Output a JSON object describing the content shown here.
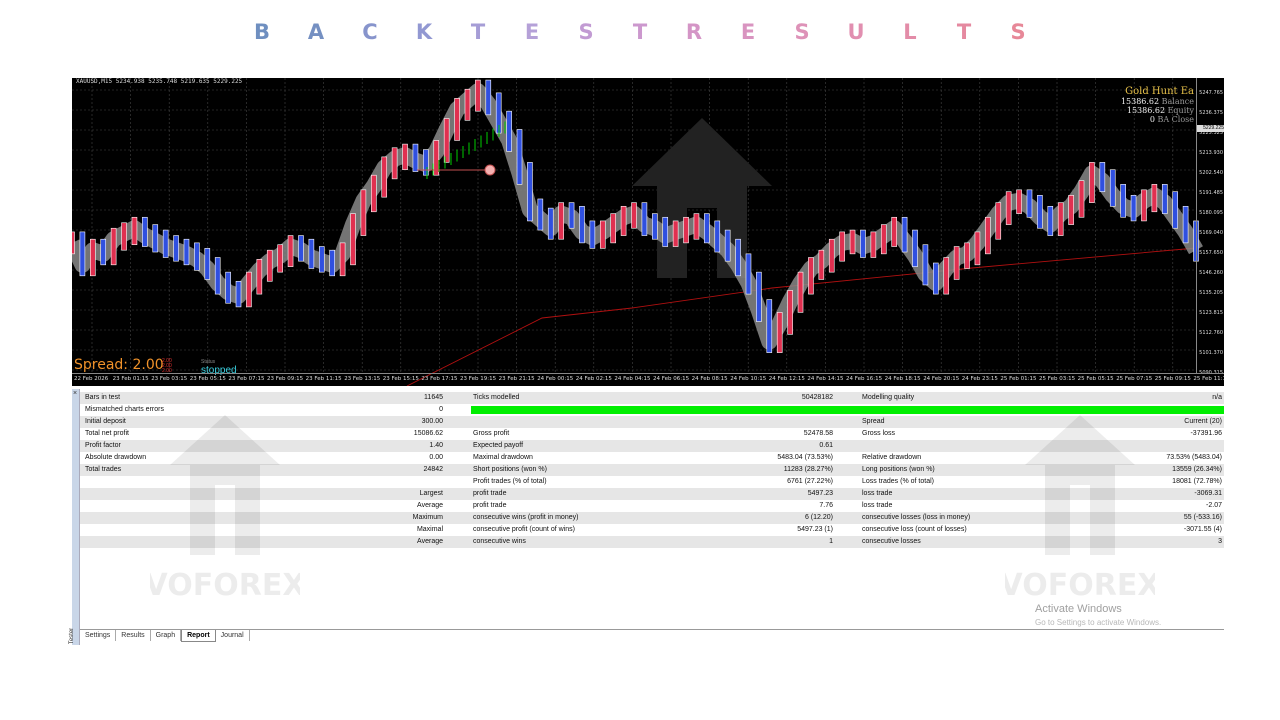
{
  "page_title": {
    "letters": [
      "B",
      "A",
      "C",
      "K",
      "T",
      "E",
      "S",
      "T",
      "R",
      "E",
      "S",
      "U",
      "L",
      "T",
      "S"
    ],
    "colors": [
      "#6f8fc0",
      "#7590c2",
      "#8794cc",
      "#9298d2",
      "#a69dd6",
      "#b5a1d8",
      "#c29bd3",
      "#cc98ce",
      "#d495c6",
      "#d994c0",
      "#de92b8",
      "#e18fb0",
      "#e38ca8",
      "#e589a0",
      "#e78898"
    ]
  },
  "chart": {
    "header": "XAUUSD,M15  5234.938 5235.748 5219.635 5229.225",
    "ea_title": "Gold Hunt Ea",
    "ea_lines": [
      {
        "value": "15386.62",
        "label": "Balance"
      },
      {
        "value": "15386.62",
        "label": "Equity"
      },
      {
        "value": "0",
        "label": "BA Close"
      }
    ],
    "price_labels": [
      "5247.765",
      "5236.375",
      "5225.325",
      "5213.930",
      "5202.540",
      "5191.485",
      "5180.095",
      "5169.040",
      "5157.650",
      "5146.260",
      "5135.205",
      "5123.815",
      "5112.760",
      "5101.370",
      "5090.315"
    ],
    "current_price": "5229.225",
    "spread_text": "Spread: 2.00",
    "spread_small": [
      "2.00",
      "2.00",
      "2.00"
    ],
    "status_label": "Status",
    "status_value": "stopped",
    "time_labels": [
      "22 Feb 2026",
      "23 Feb 01:15",
      "23 Feb 03:15",
      "23 Feb 05:15",
      "23 Feb 07:15",
      "23 Feb 09:15",
      "23 Feb 11:15",
      "23 Feb 13:15",
      "23 Feb 15:15",
      "23 Feb 17:15",
      "23 Feb 19:15",
      "23 Feb 21:15",
      "24 Feb 00:15",
      "24 Feb 02:15",
      "24 Feb 04:15",
      "24 Feb 06:15",
      "24 Feb 08:15",
      "24 Feb 10:15",
      "24 Feb 12:15",
      "24 Feb 14:15",
      "24 Feb 16:15",
      "24 Feb 18:15",
      "24 Feb 20:15",
      "24 Feb 23:15",
      "25 Feb 01:15",
      "25 Feb 03:15",
      "25 Feb 05:15",
      "25 Feb 07:15",
      "25 Feb 09:15",
      "25 Feb 11:1"
    ],
    "colors": {
      "background": "#000000",
      "grid": "#444444",
      "candle_up": "#e03050",
      "candle_down": "#3050e0",
      "glow": "#888888",
      "ma_line": "#b01010",
      "buy_marker": "#00cc00"
    },
    "price_series": [
      5162,
      5150,
      5158,
      5156,
      5164,
      5167,
      5170,
      5166,
      5163,
      5160,
      5158,
      5156,
      5153,
      5148,
      5140,
      5135,
      5133,
      5140,
      5147,
      5152,
      5155,
      5160,
      5158,
      5154,
      5152,
      5150,
      5156,
      5172,
      5185,
      5193,
      5203,
      5208,
      5210,
      5207,
      5205,
      5212,
      5224,
      5235,
      5240,
      5245,
      5238,
      5228,
      5218,
      5200,
      5180,
      5175,
      5170,
      5178,
      5176,
      5168,
      5165,
      5168,
      5172,
      5176,
      5178,
      5172,
      5170,
      5166,
      5168,
      5170,
      5172,
      5168,
      5163,
      5158,
      5150,
      5140,
      5125,
      5108,
      5118,
      5130,
      5140,
      5148,
      5152,
      5158,
      5162,
      5163,
      5160,
      5162,
      5166,
      5170,
      5163,
      5155,
      5145,
      5140,
      5148,
      5154,
      5156,
      5162,
      5170,
      5178,
      5184,
      5185,
      5182,
      5176,
      5172,
      5178,
      5182,
      5190,
      5200,
      5196,
      5188,
      5182,
      5180,
      5185,
      5188,
      5184,
      5176,
      5168,
      5158
    ]
  },
  "report": {
    "rows": [
      {
        "c1": "Bars in test",
        "v1": "11645",
        "c2": "Ticks modelled",
        "v2": "50428182",
        "c3": "Modelling quality",
        "v3": "n/a",
        "shade": true
      },
      {
        "c1": "Mismatched charts errors",
        "v1": "0",
        "c2": "",
        "v2": "",
        "c3": "",
        "v3": "",
        "shade": false,
        "bar": true
      },
      {
        "c1": "Initial deposit",
        "v1": "300.00",
        "c2": "",
        "v2": "",
        "c3": "Spread",
        "v3": "Current (20)",
        "shade": true
      },
      {
        "c1": "Total net profit",
        "v1": "15086.62",
        "c2": "Gross profit",
        "v2": "52478.58",
        "c3": "Gross loss",
        "v3": "-37391.96",
        "shade": false
      },
      {
        "c1": "Profit factor",
        "v1": "1.40",
        "c2": "Expected payoff",
        "v2": "0.61",
        "c3": "",
        "v3": "",
        "shade": true
      },
      {
        "c1": "Absolute drawdown",
        "v1": "0.00",
        "c2": "Maximal drawdown",
        "v2": "5483.04 (73.53%)",
        "c3": "Relative drawdown",
        "v3": "73.53% (5483.04)",
        "shade": false
      },
      {
        "c1": "Total trades",
        "v1": "24842",
        "c2": "Short positions (won %)",
        "v2": "11283 (28.27%)",
        "c3": "Long positions (won %)",
        "v3": "13559 (26.34%)",
        "shade": true
      },
      {
        "c1": "",
        "v1": "",
        "c2": "Profit trades (% of total)",
        "v2": "6761 (27.22%)",
        "c3": "Loss trades (% of total)",
        "v3": "18081 (72.78%)",
        "shade": false
      },
      {
        "c1": "",
        "v1": "Largest",
        "c2": "profit trade",
        "v2": "5497.23",
        "c3": "loss trade",
        "v3": "-3069.31",
        "shade": true
      },
      {
        "c1": "",
        "v1": "Average",
        "c2": "profit trade",
        "v2": "7.76",
        "c3": "loss trade",
        "v3": "-2.07",
        "shade": false
      },
      {
        "c1": "",
        "v1": "Maximum",
        "c2": "consecutive wins (profit in money)",
        "v2": "6 (12.20)",
        "c3": "consecutive losses (loss in money)",
        "v3": "55 (-533.16)",
        "shade": true
      },
      {
        "c1": "",
        "v1": "Maximal",
        "c2": "consecutive profit (count of wins)",
        "v2": "5497.23 (1)",
        "c3": "consecutive loss (count of losses)",
        "v3": "-3071.55 (4)",
        "shade": false
      },
      {
        "c1": "",
        "v1": "Average",
        "c2": "consecutive wins",
        "v2": "1",
        "c3": "consecutive losses",
        "v3": "3",
        "shade": true
      }
    ],
    "quality_bar_color": "#00ee00"
  },
  "tester": {
    "close_label": "×",
    "side_label": "Tester",
    "tabs": [
      "Settings",
      "Results",
      "Graph",
      "Report",
      "Journal"
    ],
    "active_tab": "Report"
  },
  "overlay": {
    "activate_title": "Activate Windows",
    "activate_sub": "Go to Settings to activate Windows.",
    "watermark": "VOFOREX"
  }
}
